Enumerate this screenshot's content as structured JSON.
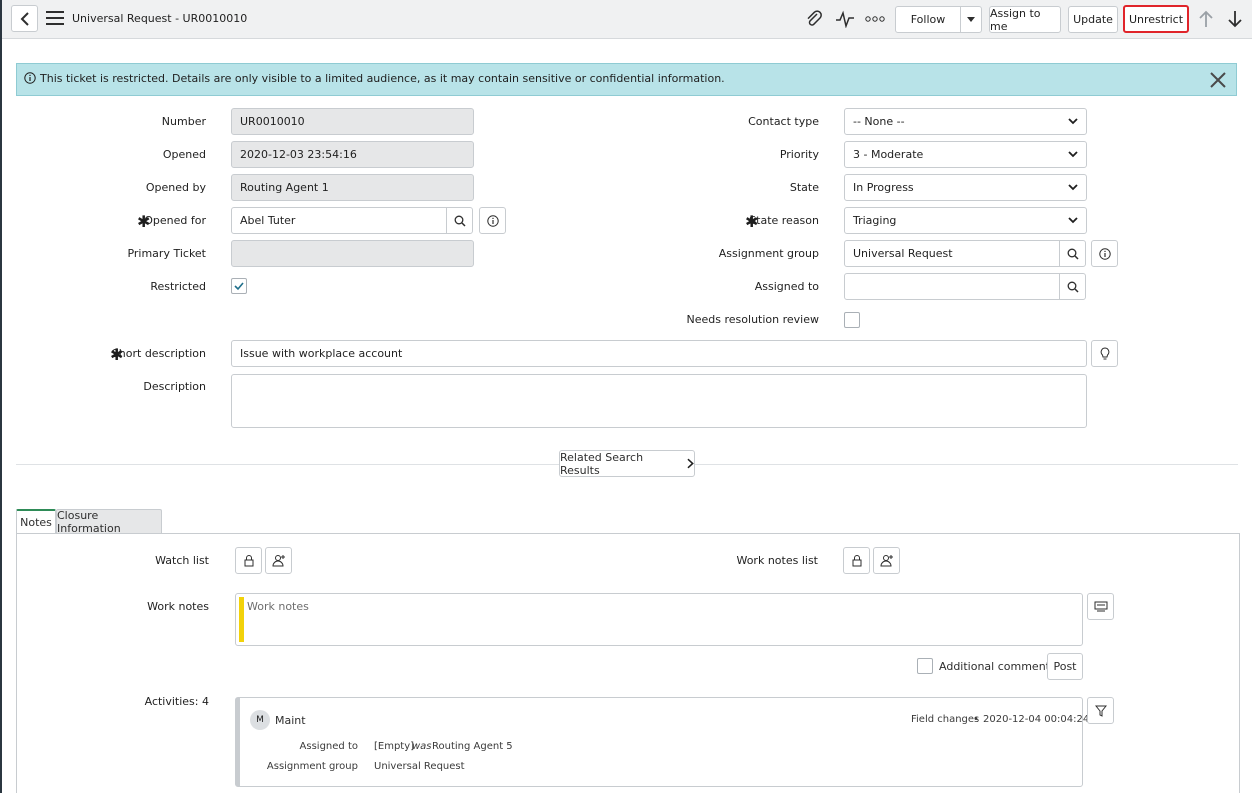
{
  "header": {
    "title": "Universal Request - UR0010010",
    "follow_label": "Follow",
    "assign_label": "Assign to me",
    "update_label": "Update",
    "unrestrict_label": "Unrestrict"
  },
  "banner": {
    "text": "This ticket is restricted. Details are only visible to a limited audience, as it may contain sensitive or confidential information."
  },
  "form": {
    "number_label": "Number",
    "number_value": "UR0010010",
    "opened_label": "Opened",
    "opened_value": "2020-12-03 23:54:16",
    "opened_by_label": "Opened by",
    "opened_by_value": "Routing Agent 1",
    "opened_for_label": "Opened for",
    "opened_for_value": "Abel Tuter",
    "primary_ticket_label": "Primary Ticket",
    "primary_ticket_value": "",
    "restricted_label": "Restricted",
    "contact_type_label": "Contact type",
    "contact_type_value": "-- None --",
    "priority_label": "Priority",
    "priority_value": "3 - Moderate",
    "state_label": "State",
    "state_value": "In Progress",
    "state_reason_label": "State reason",
    "state_reason_value": "Triaging",
    "assignment_group_label": "Assignment group",
    "assignment_group_value": "Universal Request",
    "assigned_to_label": "Assigned to",
    "assigned_to_value": "",
    "needs_review_label": "Needs resolution review",
    "short_desc_label": "Short description",
    "short_desc_value": "Issue with workplace account",
    "description_label": "Description",
    "description_value": "",
    "related_label": "Related Search Results"
  },
  "tabs": [
    {
      "label": "Notes"
    },
    {
      "label": "Closure Information"
    }
  ],
  "notes": {
    "watch_list_label": "Watch list",
    "work_notes_list_label": "Work notes list",
    "work_notes_label": "Work notes",
    "work_notes_placeholder": "Work notes",
    "additional_comments_label": "Additional comments",
    "post_label": "Post",
    "activities_label": "Activities: 4"
  },
  "activity": {
    "avatar_initial": "M",
    "user": "Maint",
    "type": "Field changes",
    "separator": "•",
    "timestamp": "2020-12-04 00:04:24",
    "rows": [
      {
        "field": "Assigned to",
        "new": "[Empty]",
        "was": "was",
        "old": "Routing Agent 5"
      },
      {
        "field": "Assignment group",
        "new": "Universal Request"
      }
    ]
  },
  "colors": {
    "banner": "#b8e3e8",
    "highlight": "#e0242a",
    "worknote_bar": "#f2d20a",
    "active_tab": "#2e8b57"
  }
}
